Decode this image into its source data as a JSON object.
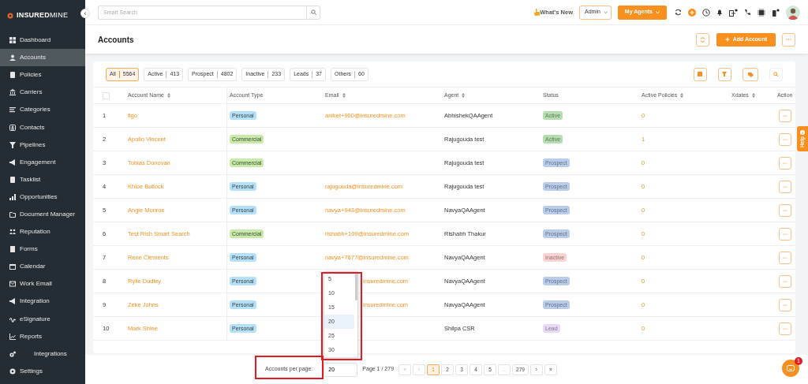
{
  "sidebar": {
    "collapse_button": "‹",
    "logo": {
      "bold": "INSURED",
      "light": "MINE"
    },
    "items": [
      {
        "label": "Dashboard",
        "selected": false
      },
      {
        "label": "Accounts",
        "selected": true
      },
      {
        "label": "Policies",
        "selected": false
      },
      {
        "label": "Carriers",
        "selected": false
      },
      {
        "label": "Categories",
        "selected": false
      },
      {
        "label": "Contacts",
        "selected": false
      },
      {
        "label": "Pipelines",
        "selected": false
      },
      {
        "label": "Engagement",
        "selected": false
      },
      {
        "label": "Tasklist",
        "selected": false
      },
      {
        "label": "Opportunities",
        "selected": false
      },
      {
        "label": "Document Manager",
        "selected": false
      },
      {
        "label": "Reputation",
        "selected": false
      },
      {
        "label": "Forms",
        "selected": false
      },
      {
        "label": "Calendar",
        "selected": false
      },
      {
        "label": "Work Email",
        "selected": false
      },
      {
        "label": "Integration",
        "selected": false
      },
      {
        "label": "eSignature",
        "selected": false
      },
      {
        "label": "Reports",
        "selected": false
      },
      {
        "label": "Integrations",
        "selected": false
      },
      {
        "label": "Settings",
        "selected": false
      }
    ]
  },
  "topbar": {
    "search": {
      "placeholder": "Smart Search"
    },
    "whats_new": "What's New",
    "role_select": "Admin",
    "agents_button": "My Agents"
  },
  "page": {
    "title": "Accounts",
    "add_button": "Add Account"
  },
  "filters": [
    {
      "label": "All",
      "count": "5564",
      "selected": true
    },
    {
      "label": "Active",
      "count": "413",
      "selected": false
    },
    {
      "label": "Prospect",
      "count": "4802",
      "selected": false
    },
    {
      "label": "Inactive",
      "count": "233",
      "selected": false
    },
    {
      "label": "Leads",
      "count": "37",
      "selected": false
    },
    {
      "label": "Others",
      "count": "60",
      "selected": false
    }
  ],
  "table": {
    "select_all": {
      "checked": false
    },
    "columns": [
      {
        "label": "Account Name",
        "sortable": true
      },
      {
        "label": "Account Type",
        "sortable": false
      },
      {
        "label": "Email",
        "sortable": true
      },
      {
        "label": "Agent",
        "sortable": true
      },
      {
        "label": "Status",
        "sortable": false
      },
      {
        "label": "Active Policies",
        "sortable": true
      },
      {
        "label": "Xdates",
        "sortable": true
      },
      {
        "label": "Action",
        "sortable": false
      }
    ],
    "rows": [
      {
        "number": "1",
        "name": "figo",
        "account_type": {
          "label": "Personal",
          "color": "#b5e0f7"
        },
        "email": "aniket+900@insuredmine.com",
        "agent": "AbhishekQAAgent",
        "status": {
          "label": "Active",
          "color": "#b5deb0"
        },
        "active_policies": "0"
      },
      {
        "number": "2",
        "name": "Apollo Vincent",
        "account_type": {
          "label": "Commercial",
          "color": "#c8eaa8"
        },
        "agent": "Rajugouda test",
        "status": {
          "label": "Active",
          "color": "#b5deb0"
        },
        "active_policies": "1"
      },
      {
        "number": "3",
        "name": "Tobias Donovan",
        "account_type": {
          "label": "Commercial",
          "color": "#c8eaa8"
        },
        "agent": "Rajugouda test",
        "status": {
          "label": "Prospect",
          "color": "#b9cdea"
        },
        "active_policies": "0"
      },
      {
        "number": "4",
        "name": "Khloe Bullock",
        "account_type": {
          "label": "Personal",
          "color": "#b5e0f7"
        },
        "email": "rajugouda@insuredmine.com",
        "agent": "Rajugouda test",
        "status": {
          "label": "Prospect",
          "color": "#b9cdea"
        },
        "active_policies": "0"
      },
      {
        "number": "5",
        "name": "Angie Monroe",
        "account_type": {
          "label": "Personal",
          "color": "#b5e0f7"
        },
        "email": "navya+943@insuredmine.com",
        "agent": "NavyaQAAgent",
        "status": {
          "label": "Prospect",
          "color": "#b9cdea"
        },
        "active_policies": "0"
      },
      {
        "number": "6",
        "name": "Test Rish Smart Search",
        "account_type": {
          "label": "Commercial",
          "color": "#c8eaa8"
        },
        "email": "rishabh+109@insuredmine.com",
        "agent": "Rishabh Thakur",
        "status": {
          "label": "Prospect",
          "color": "#b9cdea"
        },
        "active_policies": "0"
      },
      {
        "number": "7",
        "name": "Rene Clements",
        "account_type": {
          "label": "Personal",
          "color": "#b5e0f7"
        },
        "email": "navya+7677@insuredmine.com",
        "agent": "NavyaQAAgent",
        "status": {
          "label": "Inactive",
          "color": "#fbd3d3"
        },
        "active_policies": "0"
      },
      {
        "number": "8",
        "name": "Rylie Dudley",
        "account_type": {
          "label": "Personal",
          "color": "#b5e0f7"
        },
        "email": "insuredmine.com",
        "email_partly_hidden": true,
        "agent": "NavyaQAAgent",
        "status": {
          "label": "Prospect",
          "color": "#b9cdea"
        },
        "active_policies": "0"
      },
      {
        "number": "9",
        "name": "Zeke Johns",
        "account_type": {
          "label": "Personal",
          "color": "#b5e0f7"
        },
        "email": "insuredmine.com",
        "email_partly_hidden": true,
        "agent": "NavyaQAAgent",
        "status": {
          "label": "Prospect",
          "color": "#b9cdea"
        },
        "active_policies": "0"
      },
      {
        "number": "10",
        "name": "Mark Shine",
        "account_type": {
          "label": "Personal",
          "color": "#b5e0f7"
        },
        "agent": "Shilpa CSR",
        "status": {
          "label": "Lead",
          "color": "#e8daf7"
        },
        "active_policies": "0"
      }
    ]
  },
  "page_size_menu": {
    "options": [
      {
        "label": "5",
        "selected": false
      },
      {
        "label": "10",
        "selected": false
      },
      {
        "label": "15",
        "selected": false
      },
      {
        "label": "20",
        "selected": true
      },
      {
        "label": "25",
        "selected": false
      },
      {
        "label": "30",
        "selected": false
      }
    ]
  },
  "footer": {
    "per_page_label": "Accounts per page:",
    "per_page_value": "20",
    "page_info": "Page 1 / 279",
    "pages": [
      {
        "label": "«",
        "selected": false,
        "disabled": true
      },
      {
        "label": "‹",
        "selected": false,
        "disabled": true
      },
      {
        "label": "1",
        "selected": true,
        "disabled": false
      },
      {
        "label": "2",
        "selected": false,
        "disabled": false
      },
      {
        "label": "3",
        "selected": false,
        "disabled": false
      },
      {
        "label": "4",
        "selected": false,
        "disabled": false
      },
      {
        "label": "5",
        "selected": false,
        "disabled": false
      },
      {
        "label": "...",
        "selected": false,
        "disabled": true
      },
      {
        "label": "279",
        "selected": false,
        "disabled": false
      },
      {
        "label": "›",
        "selected": false,
        "disabled": false
      },
      {
        "label": "»",
        "selected": false,
        "disabled": false
      }
    ]
  },
  "help_tab": "Help",
  "chat": {
    "badge": "1"
  }
}
